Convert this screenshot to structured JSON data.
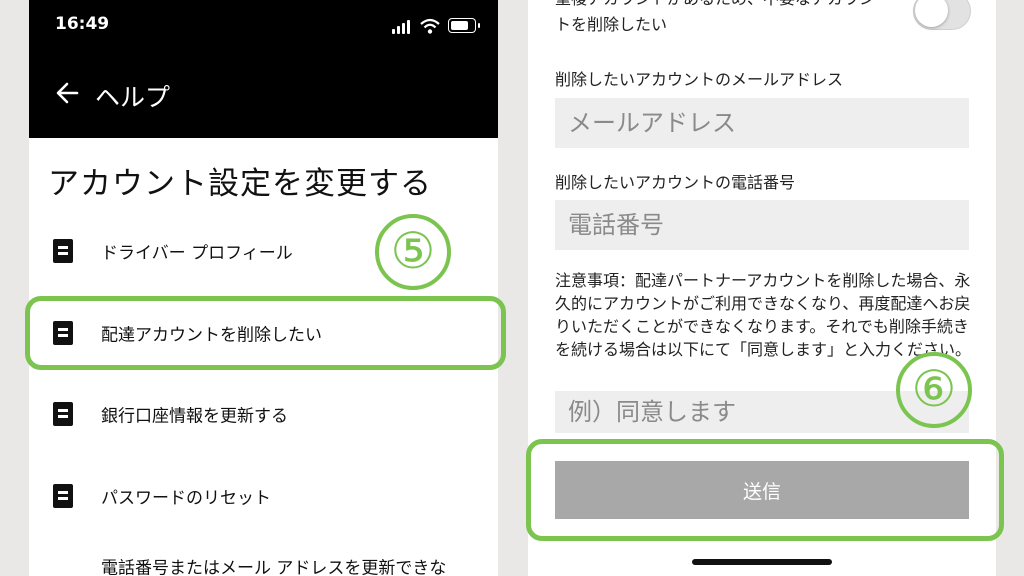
{
  "status_bar": {
    "time": "16:49"
  },
  "header": {
    "title": "ヘルプ"
  },
  "section_title": "アカウント設定を変更する",
  "help_items": [
    {
      "label": "ドライバー プロフィール"
    },
    {
      "label": "配達アカウントを削除したい"
    },
    {
      "label": "銀行口座情報を更新する"
    },
    {
      "label": "パスワードのリセット"
    },
    {
      "label": "電話番号またはメール アドレスを更新できな"
    }
  ],
  "annotations": {
    "step_5": "⑤",
    "step_6": "⑥",
    "highlight_color": "#7bc44f"
  },
  "form": {
    "duplicate_account_text": "重複アカウントがあるため、不要なアカウントを削除したい",
    "duplicate_toggle_on": false,
    "email_label": "削除したいアカウントのメールアドレス",
    "email_placeholder": "メールアドレス",
    "phone_label": "削除したいアカウントの電話番号",
    "phone_placeholder": "電話番号",
    "note": "注意事項：配達パートナーアカウントを削除した場合、永久的にアカウントがご利用できなくなり、再度配達へお戻りいただくことができなくなります。それでも削除手続きを続ける場合は以下にて「同意します」と入力ください。",
    "confirm_placeholder": "例）同意します",
    "submit_label": "送信"
  }
}
